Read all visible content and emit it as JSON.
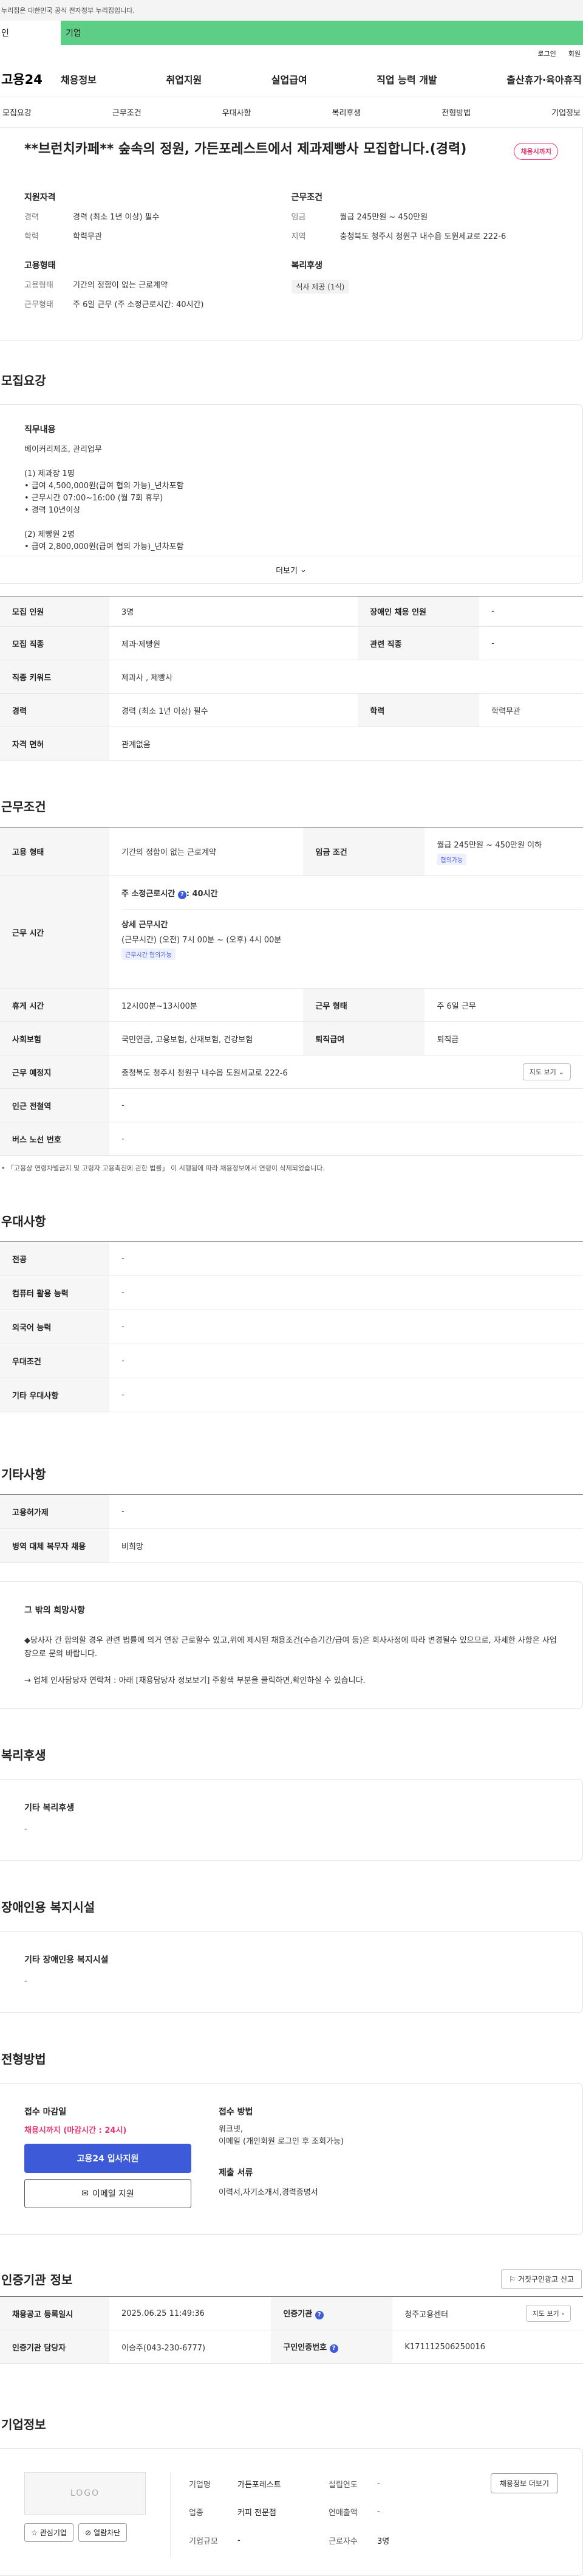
{
  "gov_banner": "누리집은 대한민국 공식 전자정부 누리집입니다.",
  "tabs": [
    "인",
    "기업"
  ],
  "util_links": [
    "로그인",
    "회원"
  ],
  "site": {
    "logo": "고용24",
    "menu": [
      "채용정보",
      "취업지원",
      "실업급여",
      "직업 능력 개발",
      "출산휴가·육아휴직"
    ]
  },
  "subnav": [
    "모집요강",
    "근무조건",
    "우대사항",
    "복리후생",
    "전형방법",
    "기업정보"
  ],
  "job": {
    "title": "**브런치카페** 숲속의 정원, 가든포레스트에서 제과제빵사 모집합니다.(경력)",
    "badge": "채용시까지",
    "qual_title": "지원자격",
    "qual": [
      {
        "k": "경력",
        "v": "경력 (최소 1년 이상) 필수"
      },
      {
        "k": "학력",
        "v": "학력무관"
      }
    ],
    "cond_title": "근무조건",
    "cond": [
      {
        "k": "임금",
        "v": "월급 245만원 ~ 450만원"
      },
      {
        "k": "지역",
        "v": "충청북도 청주시 청원구 내수읍 도원세교로 222-6"
      }
    ],
    "emp_title": "고용형태",
    "emp": [
      {
        "k": "고용형태",
        "v": "기간의 정함이 없는 근로계약"
      },
      {
        "k": "근무형태",
        "v": "주 6일 근무 (주 소정근로시간: 40시간)"
      }
    ],
    "welfare_title": "복리후생",
    "welfare_chip": "식사 제공 (1식)"
  },
  "req": {
    "heading": "모집요강",
    "title": "직무내용",
    "text": "베이커리제조, 관리업무\n\n(1) 제과장 1명\n• 급여 4,500,000원(급여 협의 가능)_년차포함\n• 근무시간 07:00~16:00 (월 7회 휴무)\n• 경력 10년이상\n\n(2) 제빵원 2명\n• 급여 2,800,000원(급여 협의 가능)_년차포함",
    "more": "더보기"
  },
  "req_table": [
    {
      "k1": "모집 인원",
      "v1": "3명",
      "k2": "장애인 채용 인원",
      "v2": "-"
    },
    {
      "k1": "모집 직종",
      "v1": "제과·제빵원",
      "k2": "관련 직종",
      "v2": "-"
    },
    {
      "k1": "직종 키워드",
      "v1": "제과사 , 제빵사"
    },
    {
      "k1": "경력",
      "v1": "경력 (최소 1년 이상) 필수",
      "k2": "학력",
      "v2": "학력무관"
    },
    {
      "k1": "자격 면허",
      "v1": "관계없음"
    }
  ],
  "cond": {
    "heading": "근무조건",
    "emp_k": "고용 형태",
    "emp_v": "기간의 정함이 없는 근로계약",
    "wage_k": "임금 조건",
    "wage_v": "월급 245만원 ~ 450만원 이하",
    "wage_tag": "협의가능",
    "hours_k": "근무 시간",
    "hours_main": "주 소정근로시간",
    "hours_val": ": 40시간",
    "hours_detail_t": "상세 근무시간",
    "hours_detail": "(근무시간) (오전) 7시 00분 ~ (오후) 4시 00분",
    "hours_tag": "근무시간 협의가능",
    "break_k": "휴게 시간",
    "break_v": "12시00분~13시00분",
    "type_k": "근무 형태",
    "type_v": "주 6일 근무",
    "ins_k": "사회보험",
    "ins_v": "국민연금, 고용보험, 산재보험, 건강보험",
    "sev_k": "퇴직급여",
    "sev_v": "퇴직금",
    "place_k": "근무 예정지",
    "place_v": "충청북도 청주시 청원구 내수읍 도원세교로 222-6",
    "map_btn": "지도 보기",
    "subway_k": "인근 전철역",
    "subway_v": "-",
    "bus_k": "버스 노선 번호",
    "bus_v": "-",
    "note": "「고용상 연령차별금지 및 고령자 고용촉진에 관한 법률」 이 시행됨에 따라 채용정보에서 연령이 삭제되었습니다."
  },
  "pref": {
    "heading": "우대사항",
    "rows": [
      {
        "k": "전공",
        "v": "-"
      },
      {
        "k": "컴퓨터 활용 능력",
        "v": "-"
      },
      {
        "k": "외국어 능력",
        "v": "-"
      },
      {
        "k": "우대조건",
        "v": "-"
      },
      {
        "k": "기타 우대사항",
        "v": "-"
      }
    ]
  },
  "etc": {
    "heading": "기타사항",
    "rows": [
      {
        "k": "고용허가제",
        "v": "-"
      },
      {
        "k": "병역 대체 복무자 채용",
        "v": "비희망"
      }
    ],
    "box_title": "그 밖의 희망사항",
    "box_p1": "◆당사자 간 합의할 경우 관련 법률에 의거 연장 근로할수 있고,위에 제시된 채용조건(수습기간/급여 등)은 회사사정에 따라 변경될수 있으므로, 자세한 사항은 사업장으로 문의 바랍니다.",
    "box_p2": "→ 업체 인사담당자 연락처 : 아래 [채용담당자 정보보기] 주황색 부분을 클릭하면,확인하실 수 있습니다."
  },
  "welfare": {
    "heading": "복리후생",
    "title": "기타 복리후생",
    "value": "-"
  },
  "disab": {
    "heading": "장애인용 복지시설",
    "title": "기타 장애인용 복지시설",
    "value": "-"
  },
  "apply": {
    "heading": "전형방법",
    "deadline_t": "접수 마감일",
    "deadline_v": "채용시까지 (마감시간 : 24시)",
    "btn1": "고용24 입사지원",
    "btn2": "이메일 지원",
    "method_t": "접수 방법",
    "method_v": "워크넷,\n이메일 (개인회원 로그인 후 조회가능)",
    "docs_t": "제출 서류",
    "docs_v": "이력서,자기소개서,경력증명서"
  },
  "cert": {
    "heading": "인증기관 정보",
    "report_btn": "거짓구인광고 신고",
    "reg_k": "채용공고 등록일시",
    "reg_v": "2025.06.25 11:49:36",
    "org_k": "인증기관",
    "org_v": "청주고용센터",
    "map_btn": "지도 보기",
    "mgr_k": "인증기관 담당자",
    "mgr_v": "이승주(043-230-6777)",
    "no_k": "구인인증번호",
    "no_v": "K171112506250016"
  },
  "company": {
    "heading": "기업정보",
    "logo": "LOGO",
    "fav": "관심기업",
    "block": "열람차단",
    "rows": [
      {
        "k1": "기업명",
        "v1": "가든포레스트",
        "k2": "설립연도",
        "v2": "-"
      },
      {
        "k1": "업종",
        "v1": "커피 전문점",
        "k2": "연매출액",
        "v2": "-"
      },
      {
        "k1": "기업규모",
        "v1": "-",
        "k2": "근로자수",
        "v2": "3명"
      }
    ],
    "list_btn": "채용정보 더보기"
  }
}
